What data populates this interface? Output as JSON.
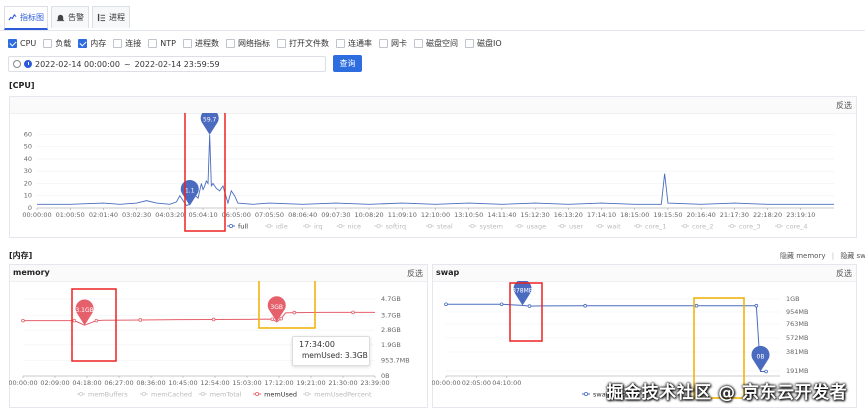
{
  "tabs": [
    {
      "label": "指标图",
      "icon": "chart-icon"
    },
    {
      "label": "告警",
      "icon": "alarm-icon"
    },
    {
      "label": "进程",
      "icon": "list-icon"
    }
  ],
  "metrics": [
    {
      "label": "CPU",
      "checked": true
    },
    {
      "label": "负载",
      "checked": false
    },
    {
      "label": "内存",
      "checked": true
    },
    {
      "label": "连接",
      "checked": false
    },
    {
      "label": "NTP",
      "checked": false
    },
    {
      "label": "进程数",
      "checked": false
    },
    {
      "label": "网络指标",
      "checked": false
    },
    {
      "label": "打开文件数",
      "checked": false
    },
    {
      "label": "连通率",
      "checked": false
    },
    {
      "label": "网卡",
      "checked": false
    },
    {
      "label": "磁盘空间",
      "checked": false
    },
    {
      "label": "磁盘IO",
      "checked": false
    }
  ],
  "date_range": {
    "start": "2022-02-14 00:00:00",
    "sep": "~",
    "end": "2022-02-14 23:59:59"
  },
  "query_label": "查询",
  "cpu_section": {
    "title": "[CPU]",
    "reverse_label": "反选"
  },
  "mem_section": {
    "title": "[内存]",
    "hide_memory": "隐藏 memory",
    "sep": "|",
    "hide_swap": "隐藏 swap"
  },
  "memory_panel": {
    "title": "memory",
    "reverse_label": "反选"
  },
  "swap_panel": {
    "title": "swap",
    "reverse_label": "反选"
  },
  "tooltip": {
    "time": "17:34:00",
    "series": "memUsed",
    "value": "3.3GB"
  },
  "watermark": "掘金技术社区 @ 京东云开发者",
  "chart_data": [
    {
      "type": "line",
      "title": "",
      "x_ticks": [
        "00:00:00",
        "01:00:50",
        "02:01:40",
        "03:02:30",
        "04:03:20",
        "05:04:10",
        "06:05:00",
        "07:05:50",
        "08:06:40",
        "09:07:30",
        "10:08:20",
        "11:09:10",
        "12:10:00",
        "13:10:50",
        "14:11:40",
        "15:12:30",
        "16:13:20",
        "17:14:10",
        "18:15:00",
        "19:15:50",
        "20:16:40",
        "21:17:30",
        "22:18:20",
        "23:19:10"
      ],
      "y_ticks": [
        0,
        10,
        20,
        30,
        40,
        50,
        60
      ],
      "ylim": [
        0,
        66
      ],
      "series": [
        {
          "name": "full",
          "active": true,
          "color": "#4a6bbf",
          "points": [
            [
              0,
              3
            ],
            [
              1,
              3
            ],
            [
              2,
              4
            ],
            [
              2.5,
              3
            ],
            [
              3,
              4
            ],
            [
              3.3,
              6
            ],
            [
              3.6,
              4
            ],
            [
              4,
              3
            ],
            [
              4.2,
              5
            ],
            [
              4.3,
              10
            ],
            [
              4.5,
              2
            ],
            [
              4.6,
              3
            ],
            [
              4.7,
              12
            ],
            [
              4.85,
              8
            ],
            [
              4.95,
              20
            ],
            [
              5.0,
              15
            ],
            [
              5.05,
              18
            ],
            [
              5.1,
              22
            ],
            [
              5.15,
              20
            ],
            [
              5.2,
              59.7
            ],
            [
              5.25,
              18
            ],
            [
              5.3,
              20
            ],
            [
              5.4,
              16
            ],
            [
              5.5,
              14
            ],
            [
              5.6,
              18
            ],
            [
              5.75,
              4
            ],
            [
              5.85,
              14
            ],
            [
              5.95,
              10
            ],
            [
              6.05,
              4
            ],
            [
              6.5,
              3
            ],
            [
              7,
              4
            ],
            [
              8,
              3
            ],
            [
              9,
              4
            ],
            [
              10,
              3
            ],
            [
              11,
              4
            ],
            [
              12,
              3
            ],
            [
              13,
              4
            ],
            [
              14,
              3
            ],
            [
              15,
              4
            ],
            [
              16,
              3
            ],
            [
              17,
              4
            ],
            [
              18,
              3
            ],
            [
              18.8,
              3
            ],
            [
              18.9,
              28
            ],
            [
              19.0,
              4
            ],
            [
              20,
              3
            ],
            [
              21,
              4
            ],
            [
              22,
              3
            ],
            [
              23,
              3
            ],
            [
              24,
              3
            ]
          ]
        },
        {
          "name": "idle",
          "active": false
        },
        {
          "name": "irq",
          "active": false
        },
        {
          "name": "nice",
          "active": false
        },
        {
          "name": "softirq",
          "active": false
        },
        {
          "name": "steal",
          "active": false
        },
        {
          "name": "system",
          "active": false
        },
        {
          "name": "usage",
          "active": false
        },
        {
          "name": "user",
          "active": false
        },
        {
          "name": "wait",
          "active": false
        },
        {
          "name": "core_1",
          "active": false
        },
        {
          "name": "core_2",
          "active": false
        },
        {
          "name": "core_3",
          "active": false
        },
        {
          "name": "core_4",
          "active": false
        }
      ],
      "markers": [
        {
          "label": "59.7",
          "x": 5.2,
          "y": 59.7,
          "color": "#4a6bbf"
        },
        {
          "label": "1.1",
          "x": 4.6,
          "y": 1.1,
          "color": "#4a6bbf"
        }
      ]
    },
    {
      "type": "line",
      "title": "memory",
      "x_ticks": [
        "00:00:00",
        "02:09:00",
        "04:18:00",
        "06:27:00",
        "08:36:00",
        "10:45:00",
        "12:54:00",
        "15:03:00",
        "17:12:00",
        "19:21:00",
        "21:30:00",
        "23:39:00"
      ],
      "y_ticks": [
        "0B",
        "953.7MB",
        "1.9GB",
        "2.8GB",
        "3.7GB",
        "4.7GB"
      ],
      "series": [
        {
          "name": "memBuffers",
          "active": false
        },
        {
          "name": "memCached",
          "active": false
        },
        {
          "name": "memTotal",
          "active": false
        },
        {
          "name": "memUsed",
          "active": true,
          "color": "#e5606b",
          "points": [
            [
              0,
              3.38
            ],
            [
              2,
              3.38
            ],
            [
              3.5,
              3.38
            ],
            [
              4.2,
              3.1
            ],
            [
              5,
              3.38
            ],
            [
              5.5,
              3.4
            ],
            [
              8,
              3.42
            ],
            [
              10.5,
              3.44
            ],
            [
              13,
              3.45
            ],
            [
              15.5,
              3.46
            ],
            [
              17,
              3.47
            ],
            [
              17.3,
              3.3
            ],
            [
              17.6,
              3.5
            ],
            [
              17.9,
              3.85
            ],
            [
              18.5,
              3.87
            ],
            [
              20.5,
              3.88
            ],
            [
              22.5,
              3.88
            ],
            [
              24,
              3.88
            ]
          ]
        },
        {
          "name": "memUsedPercent",
          "active": false
        }
      ],
      "markers": [
        {
          "label": "3.1GB",
          "x": 4.2,
          "y": 3.1,
          "color": "#e5606b"
        },
        {
          "label": "3GB",
          "x": 17.3,
          "y": 3.3,
          "color": "#e5606b"
        }
      ]
    },
    {
      "type": "line",
      "title": "swap",
      "x_ticks": [
        "00:00:00",
        "02:05:00",
        "04:10:00"
      ],
      "y_ticks": [
        "191MB",
        "381MB",
        "572MB",
        "763MB",
        "954MB",
        "1GB"
      ],
      "series": [
        {
          "name": "swapUsed",
          "active": true,
          "color": "#4a6bbf",
          "points": [
            [
              0,
              954
            ],
            [
              2,
              954
            ],
            [
              4,
              954
            ],
            [
              5.5,
              940
            ],
            [
              6,
              930
            ],
            [
              7,
              932
            ],
            [
              10,
              935
            ],
            [
              14,
              935
            ],
            [
              18,
              935
            ],
            [
              21,
              935
            ],
            [
              22.3,
              935
            ],
            [
              22.6,
              60
            ],
            [
              23,
              60
            ]
          ]
        }
      ],
      "markers": [
        {
          "label": "878MB",
          "x": 5.5,
          "y": 940,
          "color": "#4a6bbf"
        },
        {
          "label": "0B",
          "x": 22.6,
          "y": 60,
          "color": "#4a6bbf"
        }
      ]
    }
  ]
}
